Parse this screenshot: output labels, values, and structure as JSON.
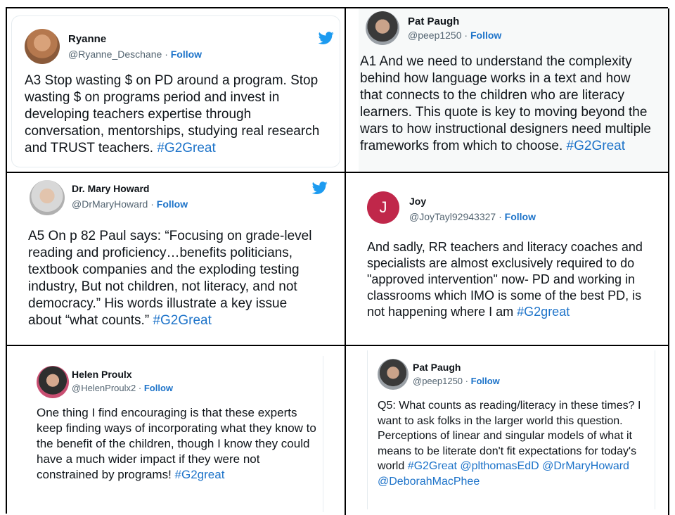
{
  "tweets": [
    {
      "name": "Ryanne",
      "handle": "@Ryanne_Deschane",
      "follow": "Follow",
      "text": "A3 Stop wasting $ on PD around a program. Stop wasting $ on programs period and invest in developing teachers expertise through conversation, mentorships, studying real research and TRUST teachers. ",
      "tags": "#G2Great"
    },
    {
      "name": "Pat Paugh",
      "handle": "@peep1250",
      "follow": "Follow",
      "text": "A1 And we need to understand the complexity behind how language works in a text and how that connects to the children who are literacy learners. This quote is key to moving beyond the wars to how instructional designers need multiple frameworks from which to choose. ",
      "tags": "#G2Great"
    },
    {
      "name": "Dr. Mary Howard",
      "handle": "@DrMaryHoward",
      "follow": "Follow",
      "text": "A5 On p 82 Paul says: “Focusing on grade-level reading and proficiency…benefits politicians, textbook companies and the exploding testing industry, But not children, not literacy, and not democracy.” His words illustrate a key issue about “what counts.” ",
      "tags": "#G2Great"
    },
    {
      "name": "Joy",
      "handle": "@JoyTayl92943327",
      "follow": "Follow",
      "avatar_letter": "J",
      "text": "And sadly, RR teachers and literacy coaches and specialists are almost exclusively required to do \"approved intervention\" now- PD and working in classrooms which IMO is some of the best PD, is not happening where I am ",
      "tags": "#G2great"
    },
    {
      "name": "Helen Proulx",
      "handle": "@HelenProulx2",
      "follow": "Follow",
      "text": "One thing I find encouraging is that these experts keep finding ways of incorporating what they know to the benefit of the children, though I know they could have a much wider impact if they were not constrained by programs! ",
      "tags": "#G2great"
    },
    {
      "name": "Pat Paugh",
      "handle": "@peep1250",
      "follow": "Follow",
      "text": "Q5: What counts as reading/literacy in these times? I want to ask folks in the larger world this question. Perceptions of linear and singular models of what it means to be literate don't fit expectations for today's world ",
      "tags": "#G2Great @plthomasEdD @DrMaryHoward @DeborahMacPhee"
    }
  ],
  "separator": "·",
  "colors": {
    "link": "#1d73c9",
    "twitter_blue": "#1d9bf0",
    "joy_avatar": "#c0274a"
  },
  "icons": {
    "bird": "twitter-bird-icon"
  }
}
